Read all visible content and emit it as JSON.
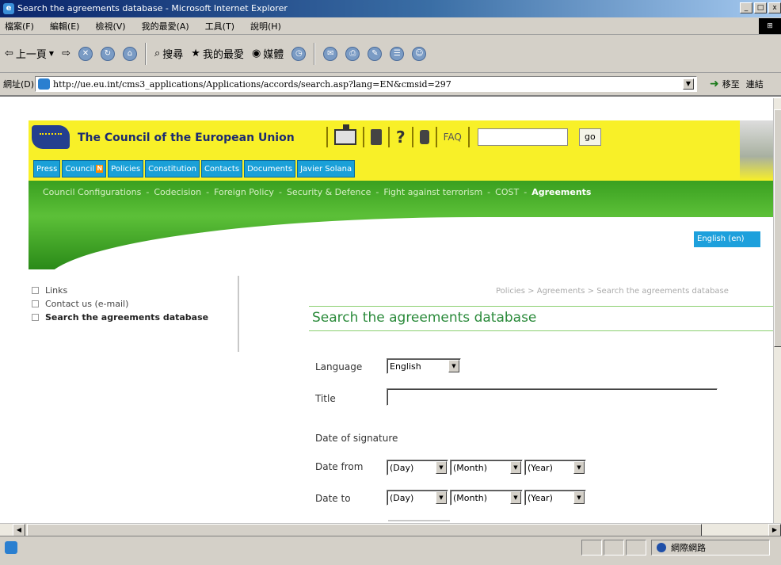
{
  "browser": {
    "window_title": "Search the agreements database - Microsoft Internet Explorer",
    "menu": [
      "檔案(F)",
      "編輯(E)",
      "檢視(V)",
      "我的最愛(A)",
      "工具(T)",
      "說明(H)"
    ],
    "toolbar": {
      "back": "上一頁",
      "search": "搜尋",
      "favorites": "我的最愛",
      "media": "媒體"
    },
    "address_label": "網址(D)",
    "url": "http://ue.eu.int/cms3_applications/Applications/accords/search.asp?lang=EN&cmsid=297",
    "go_label": "移至",
    "links_label": "連結",
    "status_zone": "網際網路"
  },
  "site": {
    "org_title": "The Council of the European Union",
    "faq": "FAQ",
    "go": "go",
    "topnav": [
      "Press",
      "Council",
      "Policies",
      "Constitution",
      "Contacts",
      "Documents",
      "Javier Solana"
    ],
    "new_badge": "N",
    "subnav": [
      "Council Configurations",
      "-",
      "Codecision",
      "-",
      "Foreign Policy",
      "-",
      "Security & Defence",
      "-",
      "Fight against terrorism",
      "-",
      "COST",
      "-",
      "Agreements"
    ],
    "language_tab": "English (en)"
  },
  "sidebar": {
    "items": [
      "Links",
      "Contact us (e-mail)",
      "Search the agreements database"
    ]
  },
  "main": {
    "breadcrumb": "Policies > Agreements > Search the agreements database",
    "heading": "Search the agreements database",
    "form": {
      "language_label": "Language",
      "language_value": "English",
      "title_label": "Title",
      "title_value": "",
      "date_signature_label": "Date of signature",
      "date_from_label": "Date from",
      "date_to_label": "Date to",
      "day": "(Day)",
      "month": "(Month)",
      "year": "(Year)"
    }
  }
}
